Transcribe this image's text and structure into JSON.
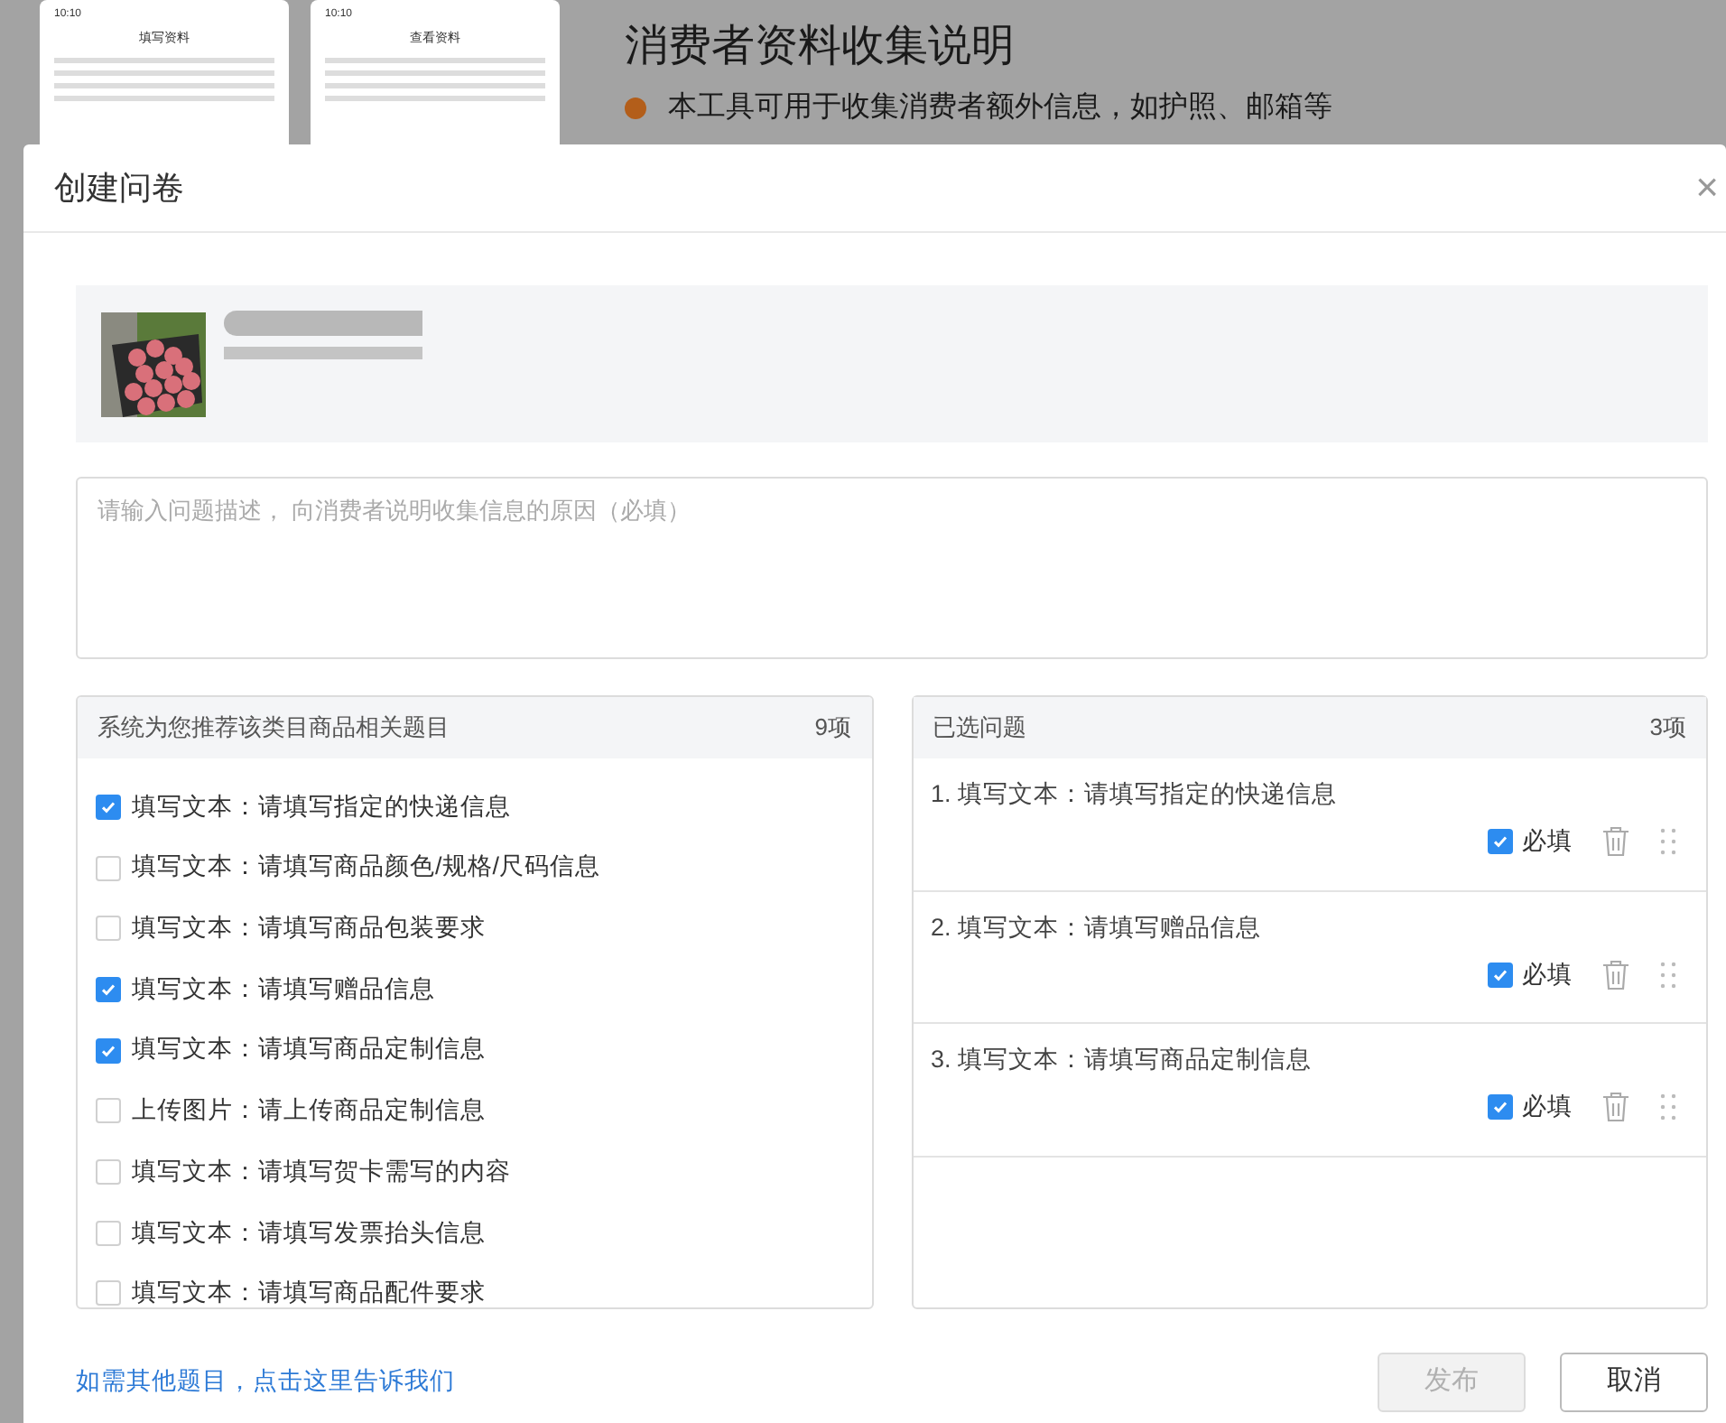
{
  "background": {
    "phones": [
      {
        "time": "10:10",
        "title": "填写资料"
      },
      {
        "time": "10:10",
        "title": "查看资料"
      }
    ],
    "heading": "消费者资料收集说明",
    "bullet": "本工具可用于收集消费者额外信息，如护照、邮箱等"
  },
  "dialog": {
    "title": "创建问卷",
    "close": "×",
    "description": {
      "placeholder": "请输入问题描述， 向消费者说明收集信息的原因（必填）"
    },
    "recommended": {
      "title": "系统为您推荐该类目商品相关题目",
      "count": "9项",
      "items": [
        {
          "label": "填写文本：请填写指定的快递信息",
          "checked": true
        },
        {
          "label": "填写文本：请填写商品颜色/规格/尺码信息",
          "checked": false
        },
        {
          "label": "填写文本：请填写商品包装要求",
          "checked": false
        },
        {
          "label": "填写文本：请填写赠品信息",
          "checked": true
        },
        {
          "label": "填写文本：请填写商品定制信息",
          "checked": true
        },
        {
          "label": "上传图片：请上传商品定制信息",
          "checked": false
        },
        {
          "label": "填写文本：请填写贺卡需写的内容",
          "checked": false
        },
        {
          "label": "填写文本：请填写发票抬头信息",
          "checked": false
        },
        {
          "label": "填写文本：请填写商品配件要求",
          "checked": false
        }
      ]
    },
    "selected": {
      "title": "已选问题",
      "count": "3项",
      "items": [
        {
          "label": "1. 填写文本：请填写指定的快递信息",
          "required_label": "必填",
          "required": true
        },
        {
          "label": "2. 填写文本：请填写赠品信息",
          "required_label": "必填",
          "required": true
        },
        {
          "label": "3. 填写文本：请填写商品定制信息",
          "required_label": "必填",
          "required": true
        }
      ]
    },
    "link": "如需其他题目，点击这里告诉我们",
    "buttons": [
      {
        "label": "发布",
        "disabled": true
      },
      {
        "label": "取消",
        "disabled": false
      }
    ]
  }
}
